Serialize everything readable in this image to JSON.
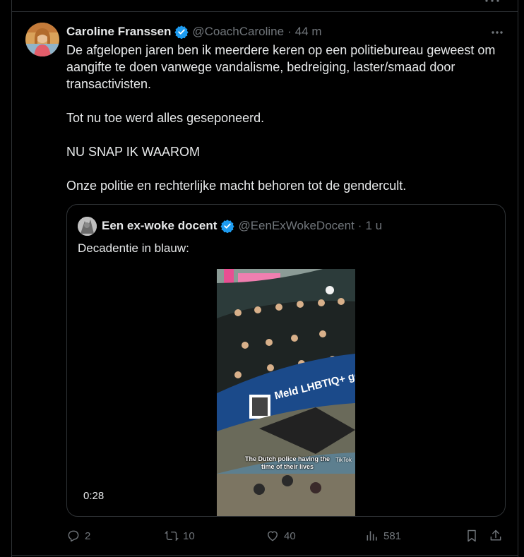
{
  "tweet": {
    "author_name": "Caroline Franssen",
    "author_handle": "@CoachCaroline",
    "separator": "·",
    "time": "44 m",
    "paragraphs": [
      "De afgelopen jaren ben ik meerdere keren op een politiebureau geweest om aangifte te doen vanwege vandalisme, bedreiging, laster/smaad door transactivisten.",
      "Tot nu toe werd alles geseponeerd.",
      "NU SNAP IK WAAROM",
      "Onze politie en rechterlijke macht behoren tot de gendercult."
    ]
  },
  "quoted": {
    "author_name": "Een ex-woke docent",
    "author_handle": "@EenExWokeDocent",
    "separator": "·",
    "time": "1 u",
    "text": "Decadentie in blauw:",
    "video": {
      "duration": "0:28",
      "caption": "The Dutch police having the time of their lives",
      "boat_text": "Meld LHBTIQ+ ge",
      "watermark": "TikTok"
    }
  },
  "actions": {
    "replies": "2",
    "reposts": "10",
    "likes": "40",
    "views": "581"
  },
  "colors": {
    "background": "#000000",
    "text": "#e7e9ea",
    "muted": "#71767b",
    "border": "#2f3336",
    "verified": "#1d9bf0"
  },
  "icons": [
    "verified-badge-icon",
    "more-icon",
    "reply-icon",
    "repost-icon",
    "like-icon",
    "views-icon",
    "bookmark-icon",
    "share-icon"
  ]
}
